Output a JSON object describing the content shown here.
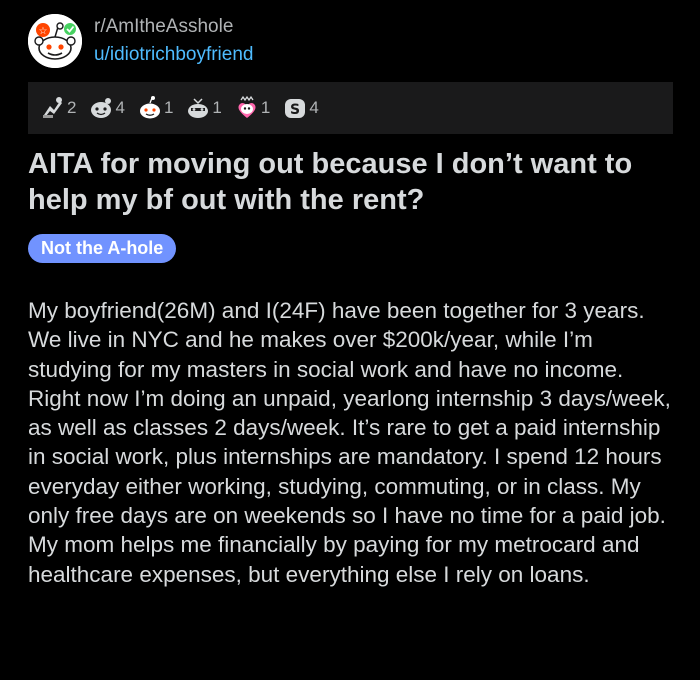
{
  "post": {
    "subreddit": "r/AmItheAsshole",
    "username": "u/idiotrichboyfriend",
    "title": "AITA for moving out because I don’t want to help my bf out with the rent?",
    "flair": "Not the A-hole",
    "body": "My boyfriend(26M) and I(24F) have been together for 3 years. We live in NYC and he makes over $200k/year, while I’m studying for my masters in social work and have no income. Right now I’m doing an unpaid, yearlong internship 3 days/week, as well as classes 2 days/week. It’s rare to get a paid internship in social work, plus internships are mandatory. I spend 12 hours everyday either working, studying, commuting, or in class. My only free days are on weekends so I have no time for a paid job. My mom helps me financially by paying for my metrocard and healthcare expenses, but everything else I rely on loans."
  },
  "awards": [
    {
      "icon": "helpful-award-icon",
      "count": "2"
    },
    {
      "icon": "wholesome-award-icon",
      "count": "4"
    },
    {
      "icon": "silver-award-icon",
      "count": "1"
    },
    {
      "icon": "snoo-party-award-icon",
      "count": "1"
    },
    {
      "icon": "heartwarming-award-icon",
      "count": "1"
    },
    {
      "icon": "money-award-icon",
      "count": "4"
    }
  ],
  "colors": {
    "background": "#000000",
    "award_bar": "#1a1a1b",
    "text": "#d7dadc",
    "username": "#4fbcff",
    "flair": "#7193ff"
  }
}
